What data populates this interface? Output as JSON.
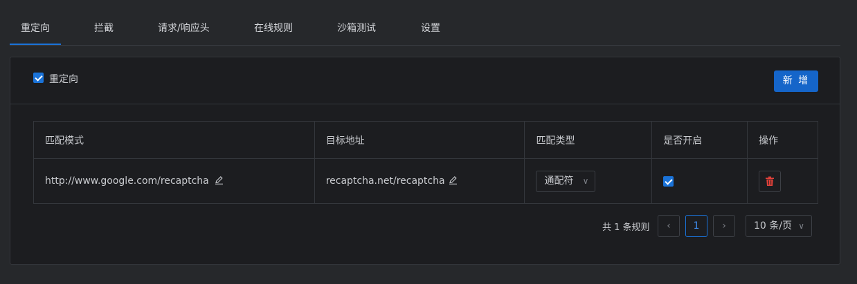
{
  "tabs": [
    {
      "label": "重定向",
      "active": true
    },
    {
      "label": "拦截"
    },
    {
      "label": "请求/响应头"
    },
    {
      "label": "在线规则"
    },
    {
      "label": "沙箱测试"
    },
    {
      "label": "设置"
    }
  ],
  "panel": {
    "enable_label": "重定向",
    "enabled": true,
    "add_button": "新 增"
  },
  "table": {
    "columns": [
      "匹配模式",
      "目标地址",
      "匹配类型",
      "是否开启",
      "操作"
    ],
    "rows": [
      {
        "pattern": "http://www.google.com/recaptcha",
        "target": "recaptcha.net/recaptcha",
        "match_type": "通配符",
        "enabled": true
      }
    ]
  },
  "pagination": {
    "total_text": "共 1 条规则",
    "current_page": "1",
    "page_size": "10 条/页"
  },
  "colors": {
    "accent": "#1a73d9",
    "danger": "#e0413a"
  },
  "icons": [
    "edit-icon",
    "checkbox-icon",
    "chevron-down-icon",
    "trash-icon",
    "chevron-left-icon",
    "chevron-right-icon"
  ]
}
